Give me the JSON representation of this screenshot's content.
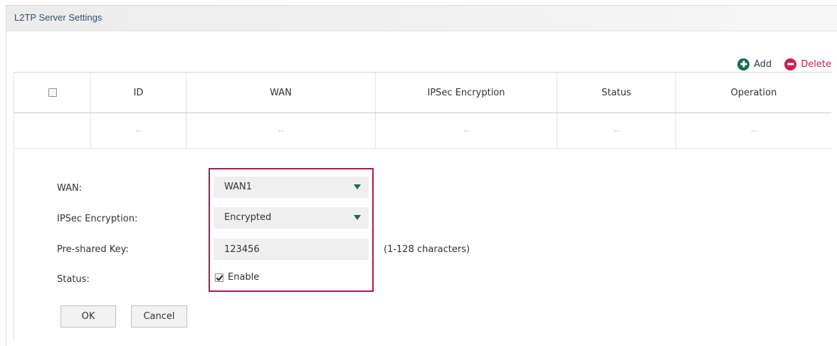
{
  "section": {
    "title": "L2TP Server Settings"
  },
  "toolbar": {
    "add_label": "Add",
    "delete_label": "Delete"
  },
  "table": {
    "headers": [
      "",
      "ID",
      "WAN",
      "IPSec Encryption",
      "Status",
      "Operation"
    ],
    "rows": [
      [
        "",
        "--",
        "--",
        "--",
        "--",
        "--"
      ]
    ]
  },
  "form": {
    "wan_label": "WAN:",
    "wan_value": "WAN1",
    "ipsec_label": "IPSec Encryption:",
    "ipsec_value": "Encrypted",
    "psk_label": "Pre-shared Key:",
    "psk_value": "123456",
    "psk_hint": "(1-128 characters)",
    "status_label": "Status:",
    "status_option": "Enable",
    "status_checked": true
  },
  "buttons": {
    "ok": "OK",
    "cancel": "Cancel"
  },
  "colors": {
    "accent_green": "#1c6b4f",
    "accent_red": "#c8204f",
    "highlight_border": "#b0174a",
    "title_color": "#2f4f73"
  },
  "icons": {
    "add": "plus-circle-icon",
    "delete": "minus-circle-icon",
    "dropdown": "triangle-down-icon"
  }
}
